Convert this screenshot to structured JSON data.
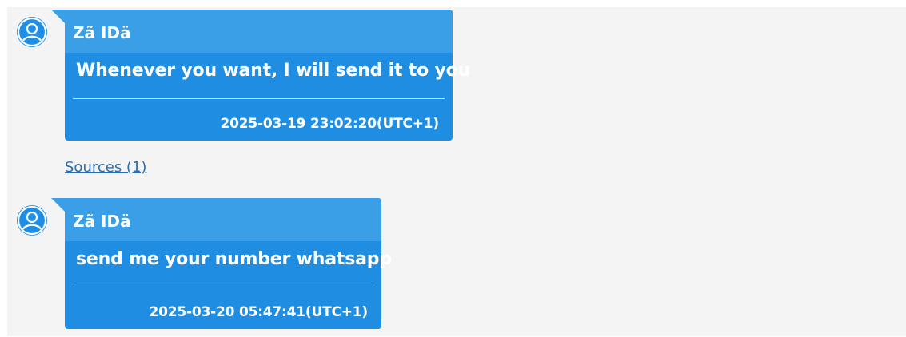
{
  "messages": [
    {
      "sender": "Zã IDä",
      "text": "Whenever you want, I will send it to you",
      "timestamp": "2025-03-19 23:02:20(UTC+1)",
      "sources_link": "Sources (1)"
    },
    {
      "sender": "Zã IDä",
      "text": "send me your number whatsapp",
      "timestamp": "2025-03-20 05:47:41(UTC+1)"
    }
  ],
  "icons": {
    "avatar": "user-avatar-icon"
  },
  "colors": {
    "bubble": "#1f8ee2",
    "bubble_header": "#3a9fe6",
    "background": "#f4f4f4",
    "link": "#2a6db3"
  }
}
